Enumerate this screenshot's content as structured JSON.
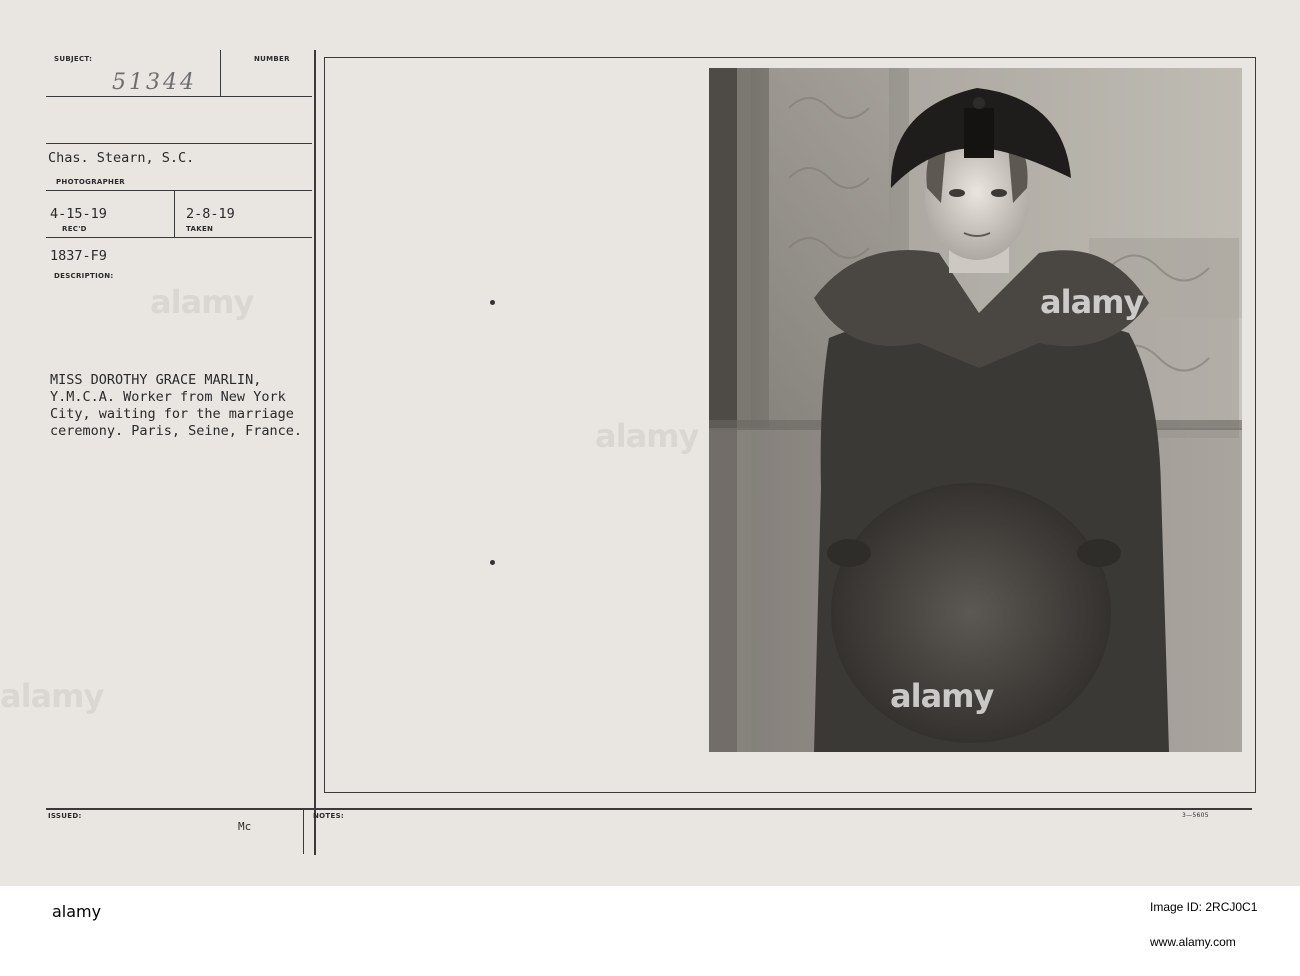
{
  "card": {
    "labels": {
      "subject": "SUBJECT:",
      "number": "NUMBER",
      "photographer": "PHOTOGRAPHER",
      "recd": "REC'D",
      "taken": "TAKEN",
      "description": "DESCRIPTION:",
      "issued": "ISSUED:",
      "notes": "NOTES:"
    },
    "handwritten_number": "51344",
    "photographer_name": "Chas. Stearn, S.C.",
    "recd_date": "4-15-19",
    "taken_date": "2-8-19",
    "reference": "1837-F9",
    "description_lines": [
      "MISS DOROTHY GRACE MARLIN,",
      "Y.M.C.A. Worker from New York",
      "City, waiting for the marriage",
      "ceremony. Paris, Seine, France."
    ],
    "issued_initials": "Mc",
    "form_code": "3—5605"
  },
  "watermark_text": "alamy",
  "footer": {
    "logo": "alamy",
    "image_id": "Image ID: 2RCJ0C1",
    "site": "www.alamy.com"
  }
}
